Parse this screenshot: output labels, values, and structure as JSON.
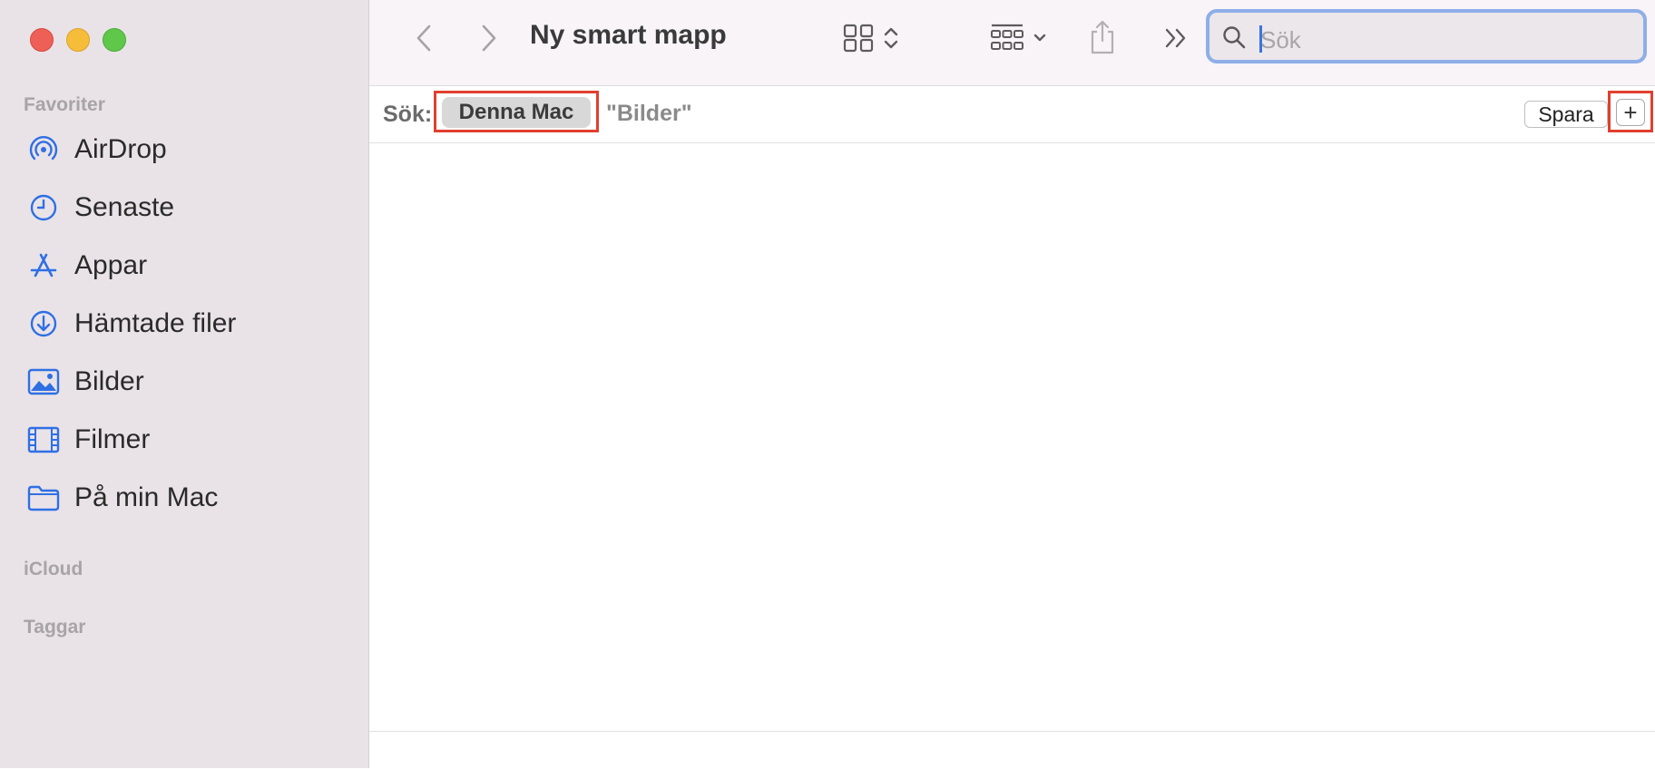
{
  "window": {
    "title": "Ny smart mapp"
  },
  "sidebar": {
    "sections": {
      "favorites": "Favoriter",
      "icloud": "iCloud",
      "tags": "Taggar"
    },
    "items": [
      {
        "label": "AirDrop",
        "icon": "airdrop-icon"
      },
      {
        "label": "Senaste",
        "icon": "clock-icon"
      },
      {
        "label": "Appar",
        "icon": "apps-icon"
      },
      {
        "label": "Hämtade filer",
        "icon": "download-icon"
      },
      {
        "label": "Bilder",
        "icon": "photo-icon"
      },
      {
        "label": "Filmer",
        "icon": "film-icon"
      },
      {
        "label": "På min Mac",
        "icon": "folder-icon"
      }
    ]
  },
  "search": {
    "placeholder": "Sök",
    "value": ""
  },
  "scopebar": {
    "label": "Sök:",
    "scope_this_mac": "Denna Mac",
    "scope_folder": "\"Bilder\"",
    "save_label": "Spara",
    "add_label": "+"
  },
  "colors": {
    "accent": "#3b74e0",
    "highlight": "#e0402f",
    "sidebar_bg": "#e9e3e7"
  }
}
